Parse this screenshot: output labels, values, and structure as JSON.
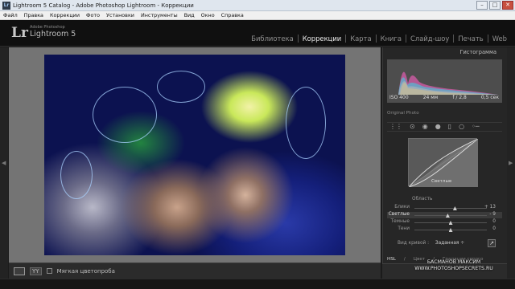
{
  "window": {
    "title": "Lightroom 5 Catalog - Adobe Photoshop Lightroom - Коррекции",
    "app_icon": "Lr"
  },
  "menu": [
    "Файл",
    "Правка",
    "Коррекции",
    "Фото",
    "Установки",
    "Инструменты",
    "Вид",
    "Окно",
    "Справка"
  ],
  "identity": {
    "adobe": "Adobe Photoshop",
    "product": "Lightroom 5",
    "logo": "Lr"
  },
  "modules": [
    {
      "label": "Библиотека",
      "active": false
    },
    {
      "label": "Коррекции",
      "active": true
    },
    {
      "label": "Карта",
      "active": false
    },
    {
      "label": "Книга",
      "active": false
    },
    {
      "label": "Слайд-шоу",
      "active": false
    },
    {
      "label": "Печать",
      "active": false
    },
    {
      "label": "Web",
      "active": false
    }
  ],
  "toolbar": {
    "yy_label": "YY",
    "soft_proof_label": "Мягкая цветопроба"
  },
  "panel": {
    "histogram_title": "Гистограмма",
    "stats": {
      "iso": "ISO 400",
      "focal": "24 мм",
      "aperture": "f / 2,8",
      "shutter": "0,5 сек"
    },
    "original_photo": "Original Photo",
    "curve_point_label": "Светлые",
    "region_title": "Область",
    "regions": [
      {
        "label": "Блики",
        "value": "+ 13",
        "level": 0.56,
        "active": false
      },
      {
        "label": "Светлые",
        "value": "- 9",
        "level": 0.46,
        "active": true
      },
      {
        "label": "Темные",
        "value": "0",
        "level": 0.5,
        "active": false
      },
      {
        "label": "Тени",
        "value": "0",
        "level": 0.5,
        "active": false
      }
    ],
    "curve_type_label": "Вид кривой :",
    "curve_type_value": "Заданная ÷",
    "tabs": [
      {
        "label": "HSL",
        "active": true
      },
      {
        "label": "/",
        "active": false
      },
      {
        "label": "Цвет",
        "active": false
      },
      {
        "label": "/",
        "active": false
      },
      {
        "label": "Градации серого",
        "active": false
      }
    ]
  },
  "watermark": {
    "line1": "БАСМАНОВ МАКСИМ",
    "line2": "WWW.PHOTOSHOPSECRETS.RU"
  }
}
